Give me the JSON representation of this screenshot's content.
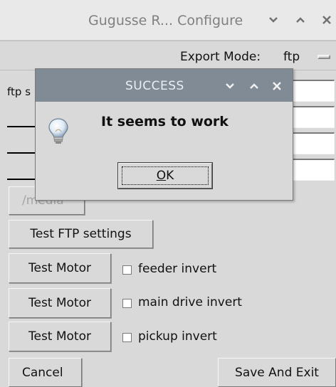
{
  "window": {
    "title": "Gugusse R... Configure",
    "controls": [
      "chevron-down-icon",
      "chevron-up-icon",
      "close-icon"
    ]
  },
  "export": {
    "label": "Export Mode:",
    "value": "ftp"
  },
  "ftp_settings": {
    "first_label_visible": "ftp s",
    "rows": 4
  },
  "buttons": {
    "media_label": "/media",
    "test_ftp": "Test FTP settings",
    "test_motor_1": "Test Motor",
    "test_motor_2": "Test Motor",
    "test_motor_3": "Test Motor",
    "cancel": "Cancel",
    "save_exit": "Save And Exit"
  },
  "checkboxes": {
    "feeder_invert": "feeder invert",
    "main_drive_invert": "main drive invert",
    "pickup_invert": "pickup invert"
  },
  "dialog": {
    "title": "SUCCESS",
    "message": "It seems to work",
    "ok_label": "OK",
    "icon": "lightbulb-icon"
  },
  "colors": {
    "window_bg": "#d9d9d9",
    "dialog_titlebar": "#808b96",
    "entry_bg": "#ffffff"
  }
}
